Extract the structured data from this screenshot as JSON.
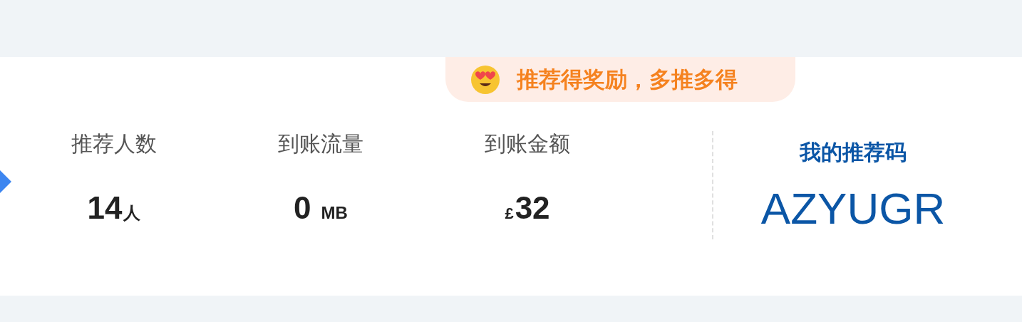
{
  "banner": {
    "text": "推荐得奖励，多推多得"
  },
  "stats": [
    {
      "label": "推荐人数",
      "value": "14",
      "suffix": "人"
    },
    {
      "label": "到账流量",
      "value": "0",
      "suffix": "MB"
    },
    {
      "label": "到账金额",
      "value": "32",
      "prefix": "£"
    }
  ],
  "referral": {
    "title": "我的推荐码",
    "code": "AZYUGR"
  }
}
